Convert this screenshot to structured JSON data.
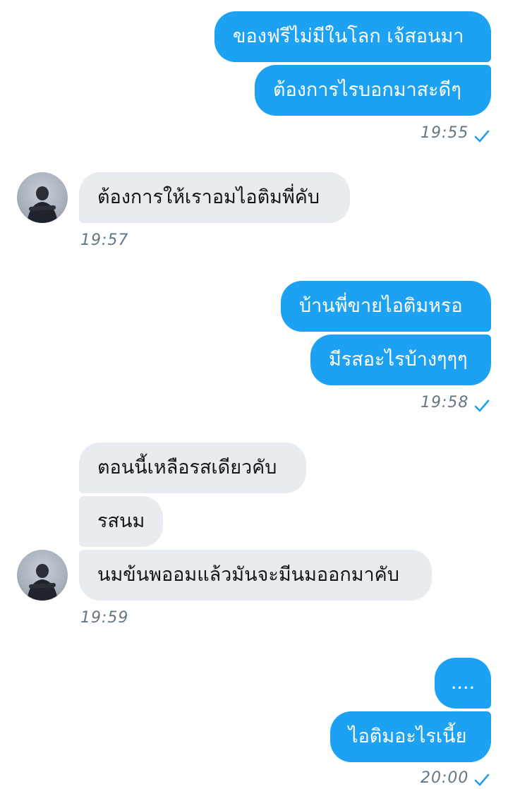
{
  "messages": {
    "group1": {
      "lines": [
        "ของฟรีไม่มีในโลก เจ้สอนมา",
        "ต้องการไรบอกมาสะดีๆ"
      ],
      "time": "19:55"
    },
    "group2": {
      "lines": [
        "ต้องการให้เราอมไอติมพี่คับ"
      ],
      "time": "19:57"
    },
    "group3": {
      "lines": [
        "บ้านพี่ขายไอติมหรอ",
        "มีรสอะไรบ้างๆๆๆ"
      ],
      "time": "19:58"
    },
    "group4": {
      "lines": [
        "ตอนนี้เหลือรสเดียวคับ",
        "รสนม",
        "นมข้นพออมแล้วมันจะมีนมออกมาคับ"
      ],
      "time": "19:59"
    },
    "group5": {
      "lines": [
        "....",
        "ไอติมอะไรเนี้ย"
      ],
      "time": "20:00"
    }
  },
  "colors": {
    "outgoing_bubble": "#1DA1F2",
    "incoming_bubble": "#E8ECF0",
    "timestamp": "#657786",
    "read_check": "#1DA1F2"
  },
  "icons": {
    "read_receipt": "check-icon",
    "avatar": "avatar"
  }
}
